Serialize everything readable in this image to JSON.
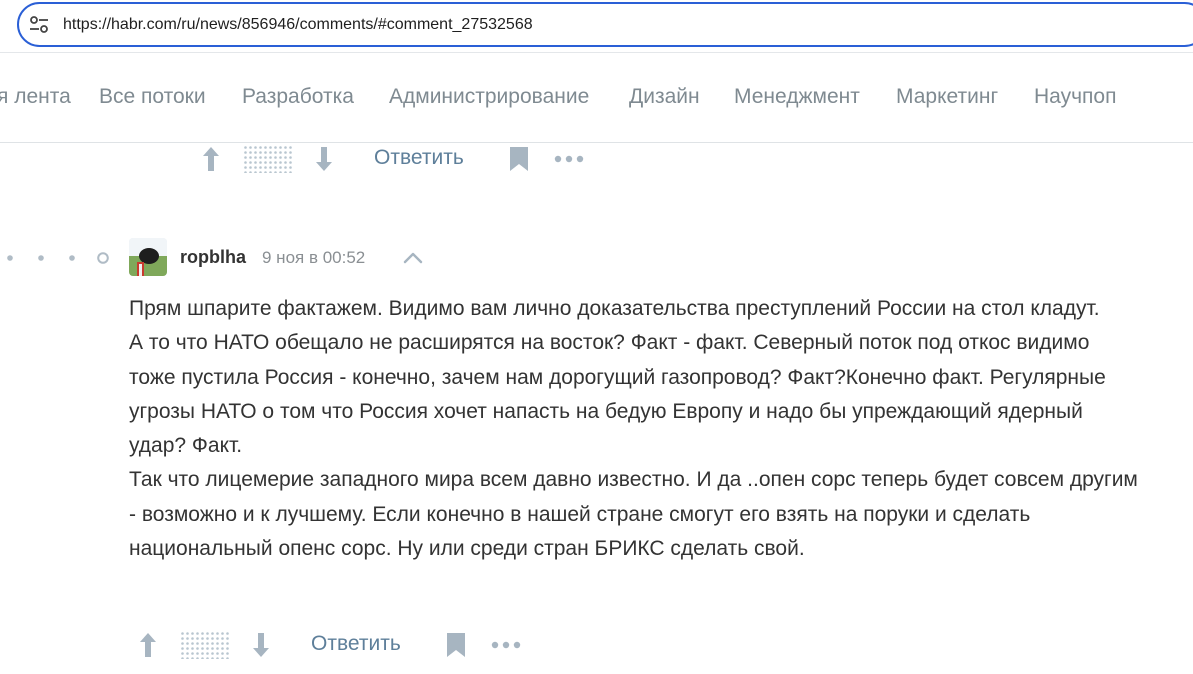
{
  "browser": {
    "url": "https://habr.com/ru/news/856946/comments/#comment_27532568",
    "icon": "site-info-icon"
  },
  "hubs": [
    {
      "label": "я лента"
    },
    {
      "label": "Все потоки"
    },
    {
      "label": "Разработка"
    },
    {
      "label": "Администрирование"
    },
    {
      "label": "Дизайн"
    },
    {
      "label": "Менеджмент"
    },
    {
      "label": "Маркетинг"
    },
    {
      "label": "Научпоп"
    }
  ],
  "prev_comment_actions": {
    "reply_label": "Ответить",
    "icons": [
      "upvote-arrow-icon",
      "hidden-score-icon",
      "downvote-arrow-icon",
      "bookmark-icon",
      "more-icon"
    ]
  },
  "comment": {
    "author": "ropblha",
    "time": "9 ноя в 00:52",
    "body": [
      "Прям шпарите фактажем. Видимо вам лично доказательства преступлений России на стол кладут.",
      "А то что НАТО обещало не расширятся на восток? Факт - факт. Северный поток под откос видимо тоже пустила Россия - конечно, зачем нам дорогущий газопровод? Факт?Конечно факт. Регулярные угрозы НАТО о том что Россия хочет напасть на бедую Европу и надо бы упреждающий ядерный удар? Факт.",
      "Так что лицемерие западного мира всем давно известно. И да ..опен сорс теперь будет совсем другим - возможно и к лучшему. Если конечно в нашей стране смогут его взять на поруки и сделать национальный опенс сорс. Ну или среди стран БРИКС сделать свой."
    ],
    "reply_label": "Ответить"
  },
  "colors": {
    "accent": "#2a5fd6",
    "link": "#5e7f9a",
    "icon": "#a7b5c1",
    "text": "#333333",
    "muted": "#8a8f93"
  }
}
